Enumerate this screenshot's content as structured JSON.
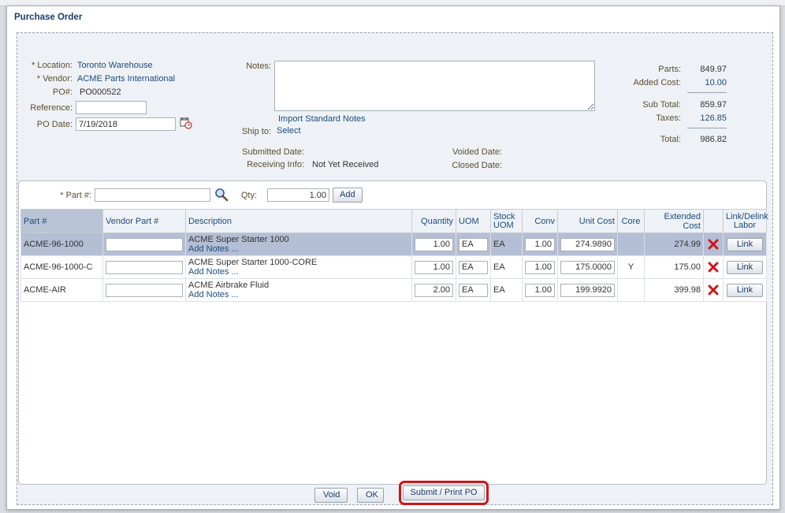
{
  "dialog": {
    "title": "Purchase Order"
  },
  "header": {
    "location_label": "* Location:",
    "location_value": "Toronto Warehouse",
    "vendor_label": "* Vendor:",
    "vendor_value": "ACME Parts International",
    "po_label": "PO#:",
    "po_value": "PO000522",
    "reference_label": "Reference:",
    "reference_value": "",
    "po_date_label": "PO Date:",
    "po_date_value": "7/19/2018",
    "notes_label": "Notes:",
    "notes_value": "",
    "import_notes": "Import Standard Notes",
    "ship_to_label": "Ship to:",
    "ship_to_value": "Select",
    "submitted_label": "Submitted Date:",
    "submitted_value": "",
    "receiving_label": "Receiving Info:",
    "receiving_value": "Not Yet Received",
    "voided_label": "Voided Date:",
    "voided_value": "",
    "closed_label": "Closed Date:",
    "closed_value": ""
  },
  "totals": {
    "parts_label": "Parts:",
    "parts_value": "849.97",
    "added_label": "Added Cost:",
    "added_value": "10.00",
    "subtotal_label": "Sub Total:",
    "subtotal_value": "859.97",
    "taxes_label": "Taxes:",
    "taxes_value": "126.85",
    "total_label": "Total:",
    "total_value": "986.82"
  },
  "add_bar": {
    "part_label": "* Part #:",
    "part_value": "",
    "qty_label": "Qty:",
    "qty_value": "1.00",
    "add_button": "Add"
  },
  "grid": {
    "columns": {
      "part": "Part #",
      "vendor_part": "Vendor Part #",
      "description": "Description",
      "quantity": "Quantity",
      "uom": "UOM",
      "stock_uom_1": "Stock",
      "stock_uom_2": "UOM",
      "conv": "Conv",
      "unit_cost": "Unit Cost",
      "core": "Core",
      "extended": "Extended Cost",
      "link_1": "Link/Delink",
      "link_2": "Labor"
    },
    "rows": [
      {
        "part": "ACME-96-1000",
        "vendor_part": "",
        "description": "ACME Super Starter 1000",
        "add_notes": "Add Notes ...",
        "quantity": "1.00",
        "uom": "EA",
        "stock_uom": "EA",
        "conv": "1.00",
        "unit_cost": "274.9890",
        "core": "",
        "extended": "274.99",
        "link": "Link"
      },
      {
        "part": "ACME-96-1000-C",
        "vendor_part": "",
        "description": "ACME Super Starter 1000-CORE",
        "add_notes": "Add Notes ...",
        "quantity": "1.00",
        "uom": "EA",
        "stock_uom": "EA",
        "conv": "1.00",
        "unit_cost": "175.0000",
        "core": "Y",
        "extended": "175.00",
        "link": "Link"
      },
      {
        "part": "ACME-AIR",
        "vendor_part": "",
        "description": "ACME Airbrake Fluid",
        "add_notes": "Add Notes ...",
        "quantity": "2.00",
        "uom": "EA",
        "stock_uom": "EA",
        "conv": "1.00",
        "unit_cost": "199.9920",
        "core": "",
        "extended": "399.98",
        "link": "Link"
      }
    ]
  },
  "footer": {
    "void_button": "Void",
    "ok_button": "OK",
    "submit_button": "Submit / Print PO"
  },
  "icons": {
    "search": "magnifier-icon",
    "calendar": "calendar-clock-icon",
    "delete": "red-x-icon"
  },
  "colors": {
    "accent": "#1a4c82",
    "selected_row": "#b4bed4",
    "highlight_border": "#d0141a",
    "delete": "#d0141a"
  }
}
